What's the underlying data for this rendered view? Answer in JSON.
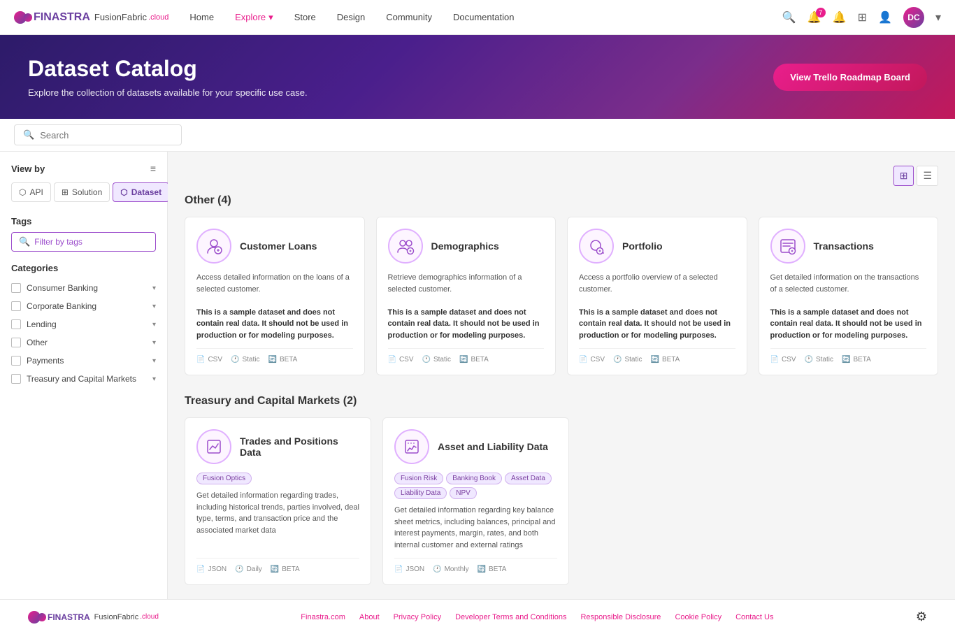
{
  "brand": {
    "name": "FINASTRA",
    "fusion_fabric": "FusionFabric",
    "cloud_label": ".cloud"
  },
  "navbar": {
    "links": [
      {
        "id": "home",
        "label": "Home",
        "active": false
      },
      {
        "id": "explore",
        "label": "Explore",
        "active": true,
        "has_dropdown": true
      },
      {
        "id": "store",
        "label": "Store",
        "active": false
      },
      {
        "id": "design",
        "label": "Design",
        "active": false
      },
      {
        "id": "community",
        "label": "Community",
        "active": false
      },
      {
        "id": "documentation",
        "label": "Documentation",
        "active": false
      }
    ],
    "user_initials": "DC",
    "notification_count": "7"
  },
  "hero": {
    "title": "Dataset Catalog",
    "subtitle": "Explore the collection of datasets available for your specific use case.",
    "cta_button": "View Trello Roadmap Board"
  },
  "search": {
    "placeholder": "Search"
  },
  "sidebar": {
    "view_by_label": "View by",
    "tabs": [
      {
        "id": "api",
        "label": "API",
        "active": false
      },
      {
        "id": "solution",
        "label": "Solution",
        "active": false
      },
      {
        "id": "dataset",
        "label": "Dataset",
        "active": true
      }
    ],
    "tags_label": "Tags",
    "tags_filter_placeholder": "Filter by tags",
    "categories_label": "Categories",
    "categories": [
      {
        "id": "consumer-banking",
        "label": "Consumer Banking"
      },
      {
        "id": "corporate-banking",
        "label": "Corporate Banking"
      },
      {
        "id": "lending",
        "label": "Lending"
      },
      {
        "id": "other",
        "label": "Other"
      },
      {
        "id": "payments",
        "label": "Payments"
      },
      {
        "id": "treasury-capital-markets",
        "label": "Treasury and Capital Markets"
      }
    ]
  },
  "content": {
    "sections": [
      {
        "id": "other",
        "heading": "Other (4)",
        "cards": [
          {
            "id": "customer-loans",
            "title": "Customer Loans",
            "icon": "👤",
            "tags": [],
            "description": "Access detailed information on the loans of a selected customer.",
            "sample_warning": "This is a sample dataset and does not contain real data. It should not be used in production or for modeling purposes.",
            "format": "CSV",
            "update": "Static",
            "status": "BETA"
          },
          {
            "id": "demographics",
            "title": "Demographics",
            "icon": "👥",
            "tags": [],
            "description": "Retrieve demographics information of a selected customer.",
            "sample_warning": "This is a sample dataset and does not contain real data. It should not be used in production or for modeling purposes.",
            "format": "CSV",
            "update": "Static",
            "status": "BETA"
          },
          {
            "id": "portfolio",
            "title": "Portfolio",
            "icon": "🔍",
            "tags": [],
            "description": "Access a portfolio overview of a selected customer.",
            "sample_warning": "This is a sample dataset and does not contain real data. It should not be used in production or for modeling purposes.",
            "format": "CSV",
            "update": "Static",
            "status": "BETA"
          },
          {
            "id": "transactions",
            "title": "Transactions",
            "icon": "💱",
            "tags": [],
            "description": "Get detailed information on the transactions of a selected customer.",
            "sample_warning": "This is a sample dataset and does not contain real data. It should not be used in production or for modeling purposes.",
            "format": "CSV",
            "update": "Static",
            "status": "BETA"
          }
        ]
      },
      {
        "id": "treasury-capital-markets",
        "heading": "Treasury and Capital Markets (2)",
        "cards": [
          {
            "id": "trades-positions",
            "title": "Trades and Positions Data",
            "icon": "📊",
            "tags": [
              "Fusion Optics"
            ],
            "description": "Get detailed information regarding trades, including historical trends, parties involved, deal type, terms, and transaction price and the associated market data",
            "sample_warning": "",
            "format": "JSON",
            "update": "Daily",
            "status": "BETA"
          },
          {
            "id": "asset-liability",
            "title": "Asset and Liability Data",
            "icon": "📈",
            "tags": [
              "Fusion Risk",
              "Banking Book",
              "Asset Data",
              "Liability Data",
              "NPV"
            ],
            "description": "Get detailed information regarding key balance sheet metrics, including balances, principal and interest payments, margin, rates, and both internal customer and external ratings",
            "sample_warning": "",
            "format": "JSON",
            "update": "Monthly",
            "status": "BETA"
          }
        ]
      }
    ]
  },
  "footer": {
    "links": [
      {
        "id": "finastra-com",
        "label": "Finastra.com"
      },
      {
        "id": "about",
        "label": "About"
      },
      {
        "id": "privacy-policy",
        "label": "Privacy Policy"
      },
      {
        "id": "developer-terms",
        "label": "Developer Terms and Conditions"
      },
      {
        "id": "responsible-disclosure",
        "label": "Responsible Disclosure"
      },
      {
        "id": "cookie-policy",
        "label": "Cookie Policy"
      },
      {
        "id": "contact-us",
        "label": "Contact Us"
      }
    ]
  }
}
